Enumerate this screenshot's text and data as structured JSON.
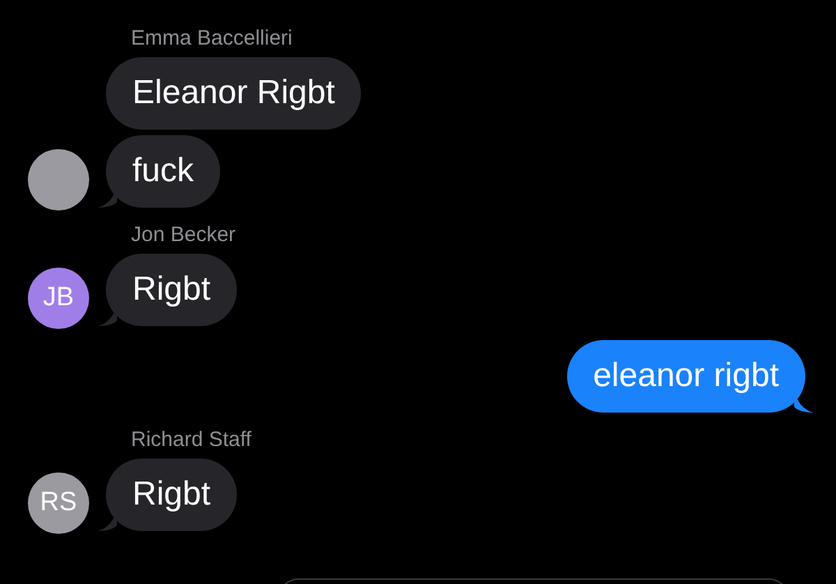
{
  "messages": [
    {
      "sender": "Emma Baccellieri",
      "text": "Eleanor Rigbt",
      "from_me": false,
      "tail": false
    },
    {
      "text": "fuck",
      "from_me": false,
      "tail": true,
      "avatar": {
        "color": "#9a9aa0"
      }
    },
    {
      "sender": "Jon Becker",
      "text": "Rigbt",
      "from_me": false,
      "tail": true,
      "avatar": {
        "initials": "JB",
        "color": "#a07ee8"
      }
    },
    {
      "text": "eleanor rigbt",
      "from_me": true,
      "tail": true
    },
    {
      "sender": "Richard Staff",
      "text": "Rigbt",
      "from_me": false,
      "tail": true,
      "avatar": {
        "initials": "RS",
        "color": "#9a9aa0"
      }
    }
  ],
  "composer": {
    "visible": true
  }
}
